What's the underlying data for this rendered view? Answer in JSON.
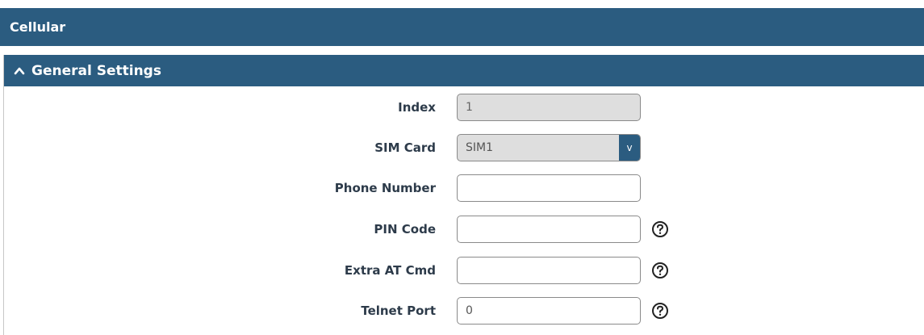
{
  "header": {
    "title": "Cellular"
  },
  "panel": {
    "title": "General Settings",
    "expanded": true
  },
  "fields": {
    "index": {
      "label": "Index",
      "value": "1"
    },
    "sim_card": {
      "label": "SIM Card",
      "value": "SIM1",
      "arrow": "v"
    },
    "phone_number": {
      "label": "Phone Number",
      "value": ""
    },
    "pin_code": {
      "label": "PIN Code",
      "value": ""
    },
    "extra_at_cmd": {
      "label": "Extra AT Cmd",
      "value": ""
    },
    "telnet_port": {
      "label": "Telnet Port",
      "value": "0"
    }
  },
  "icons": {
    "panel_toggle": "chevron-up-icon",
    "help": "question-circle-icon"
  },
  "colors": {
    "header_bg": "#2b5c80",
    "header_text": "#ffffff",
    "label_text": "#2d3b4a",
    "readonly_bg": "#dedede"
  }
}
